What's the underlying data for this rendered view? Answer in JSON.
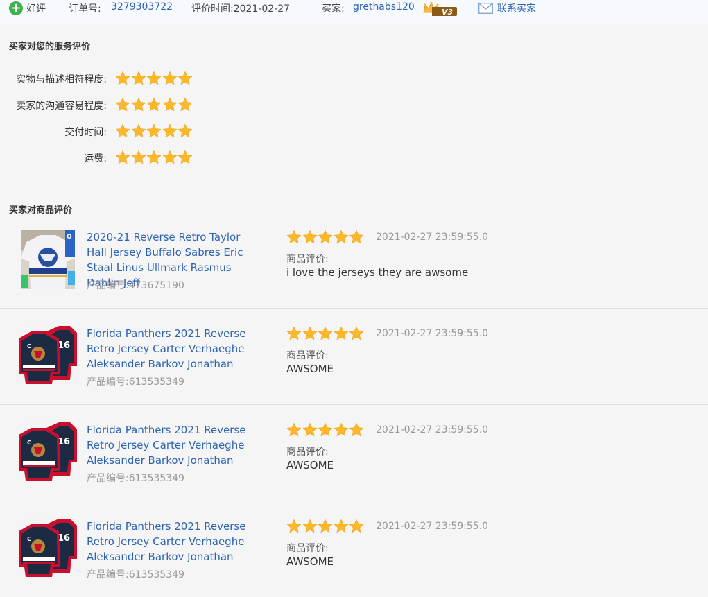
{
  "header": {
    "rating_type": "好评",
    "order_label": "订单号:",
    "order_number": "3279303722",
    "time_label": "评价时间:",
    "time_value": "2021-02-27",
    "buyer_label": "买家:",
    "buyer_name": "grethabs120",
    "buyer_level": "V3",
    "contact_label": "联系买家"
  },
  "service": {
    "title": "买家对您的服务评价",
    "criteria": [
      {
        "label": "实物与描述相符程度:",
        "stars": 5
      },
      {
        "label": "卖家的沟通容易程度:",
        "stars": 5
      },
      {
        "label": "交付时间:",
        "stars": 5
      },
      {
        "label": "运费:",
        "stars": 5
      }
    ]
  },
  "products": {
    "title": "买家对商品评价",
    "code_label": "产品编号:",
    "comment_label": "商品评价:",
    "items": [
      {
        "title": "2020-21 Reverse Retro Taylor Hall Jersey Buffalo Sabres Eric Staal Linus Ullmark Rasmus Dahlin Jeff",
        "code": "473675190",
        "stars": 5,
        "time": "2021-02-27 23:59:55.0",
        "comment": "i love the jerseys they are awsome"
      },
      {
        "title": "Florida Panthers 2021 Reverse Retro Jersey Carter Verhaeghe Aleksander Barkov Jonathan",
        "code": "613535349",
        "stars": 5,
        "time": "2021-02-27 23:59:55.0",
        "comment": "AWSOME"
      },
      {
        "title": "Florida Panthers 2021 Reverse Retro Jersey Carter Verhaeghe Aleksander Barkov Jonathan",
        "code": "613535349",
        "stars": 5,
        "time": "2021-02-27 23:59:55.0",
        "comment": "AWSOME"
      },
      {
        "title": "Florida Panthers 2021 Reverse Retro Jersey Carter Verhaeghe Aleksander Barkov Jonathan",
        "code": "613535349",
        "stars": 5,
        "time": "2021-02-27 23:59:55.0",
        "comment": "AWSOME"
      }
    ]
  },
  "colors": {
    "link": "#2d63b3",
    "star": "#fbb82a",
    "positive": "#3db24b",
    "background": "#f5f5f5"
  }
}
